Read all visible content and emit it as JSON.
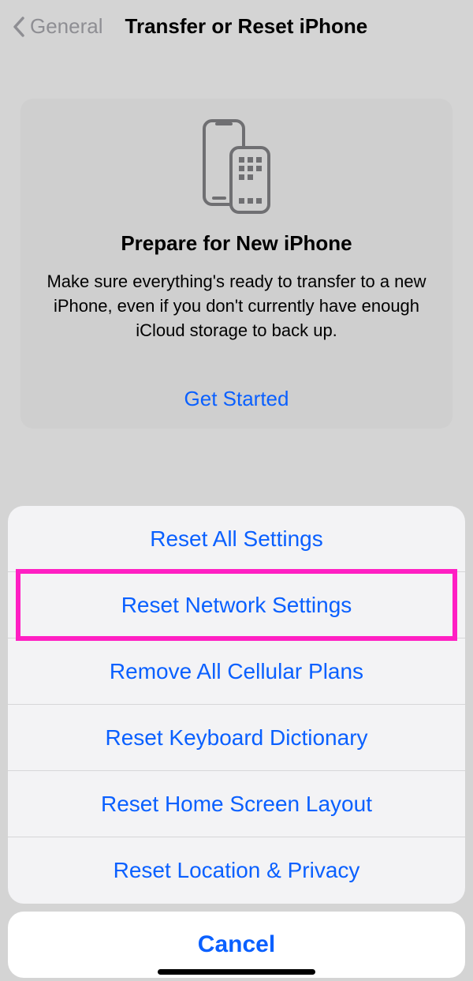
{
  "nav": {
    "back_label": "General",
    "title": "Transfer or Reset iPhone"
  },
  "prepare_card": {
    "title": "Prepare for New iPhone",
    "description": "Make sure everything's ready to transfer to a new iPhone, even if you don't currently have enough iCloud storage to back up.",
    "cta": "Get Started"
  },
  "reset_sheet": {
    "options": [
      {
        "label": "Reset All Settings",
        "highlighted": false
      },
      {
        "label": "Reset Network Settings",
        "highlighted": true
      },
      {
        "label": "Remove All Cellular Plans",
        "highlighted": false
      },
      {
        "label": "Reset Keyboard Dictionary",
        "highlighted": false
      },
      {
        "label": "Reset Home Screen Layout",
        "highlighted": false
      },
      {
        "label": "Reset Location & Privacy",
        "highlighted": false
      }
    ],
    "cancel_label": "Cancel"
  },
  "colors": {
    "ios_blue": "#0a60ff",
    "highlight_pink": "#ff1fc3",
    "bg_gray": "#d4d4d4"
  }
}
